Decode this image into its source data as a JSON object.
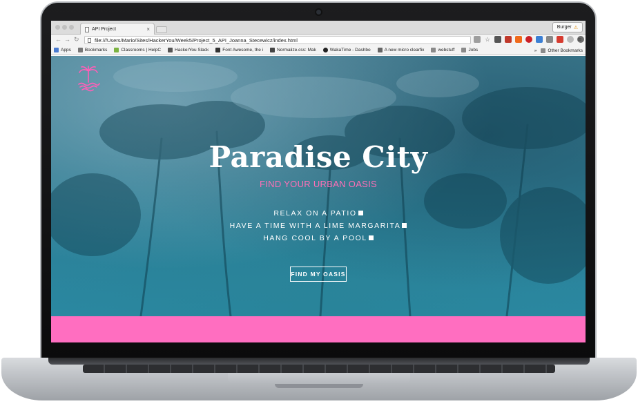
{
  "browser": {
    "tab_title": "API Project",
    "tab_close": "×",
    "profile_label": "Burger",
    "url": "file:///Users/Mario/Sites/HackerYou/Week5/Project_5_API_Joanna_Stecewicz/index.html",
    "bookmarks": [
      {
        "label": "Apps",
        "icon": "apps-grid-icon",
        "color": "#4a7bd0"
      },
      {
        "label": "Bookmarks",
        "icon": "star-icon",
        "color": "#777777"
      },
      {
        "label": "Classrooms | HelpC",
        "icon": "leaf-icon",
        "color": "#7cb342"
      },
      {
        "label": "HackerYou Slack",
        "icon": "page-icon",
        "color": "#555555"
      },
      {
        "label": "Font Awesome, the i",
        "icon": "flag-icon",
        "color": "#333333"
      },
      {
        "label": "Normalize.css: Mak",
        "icon": "n-icon",
        "color": "#444444"
      },
      {
        "label": "WakaTime - Dashbo",
        "icon": "clock-icon",
        "color": "#222222"
      },
      {
        "label": "A new micro clearfix",
        "icon": "page-icon",
        "color": "#666666"
      },
      {
        "label": "webstuff",
        "icon": "folder-icon",
        "color": "#8a8a8a"
      },
      {
        "label": "Jobs",
        "icon": "folder-icon",
        "color": "#8a8a8a"
      }
    ],
    "bookmarks_overflow": "»",
    "other_bookmarks": "Other Bookmarks"
  },
  "hero": {
    "title": "Paradise City",
    "subtitle": "FIND YOUR URBAN OASIS",
    "features": [
      "RELAX ON A PATIO",
      "HAVE A TIME WITH A LIME MARGARITA",
      "HANG COOL BY A POOL"
    ],
    "cta_label": "FIND MY OASIS"
  },
  "colors": {
    "accent_pink": "#ff6ec0",
    "hero_teal": "#2d7b92",
    "subtitle_pink": "#ff6fb7"
  }
}
